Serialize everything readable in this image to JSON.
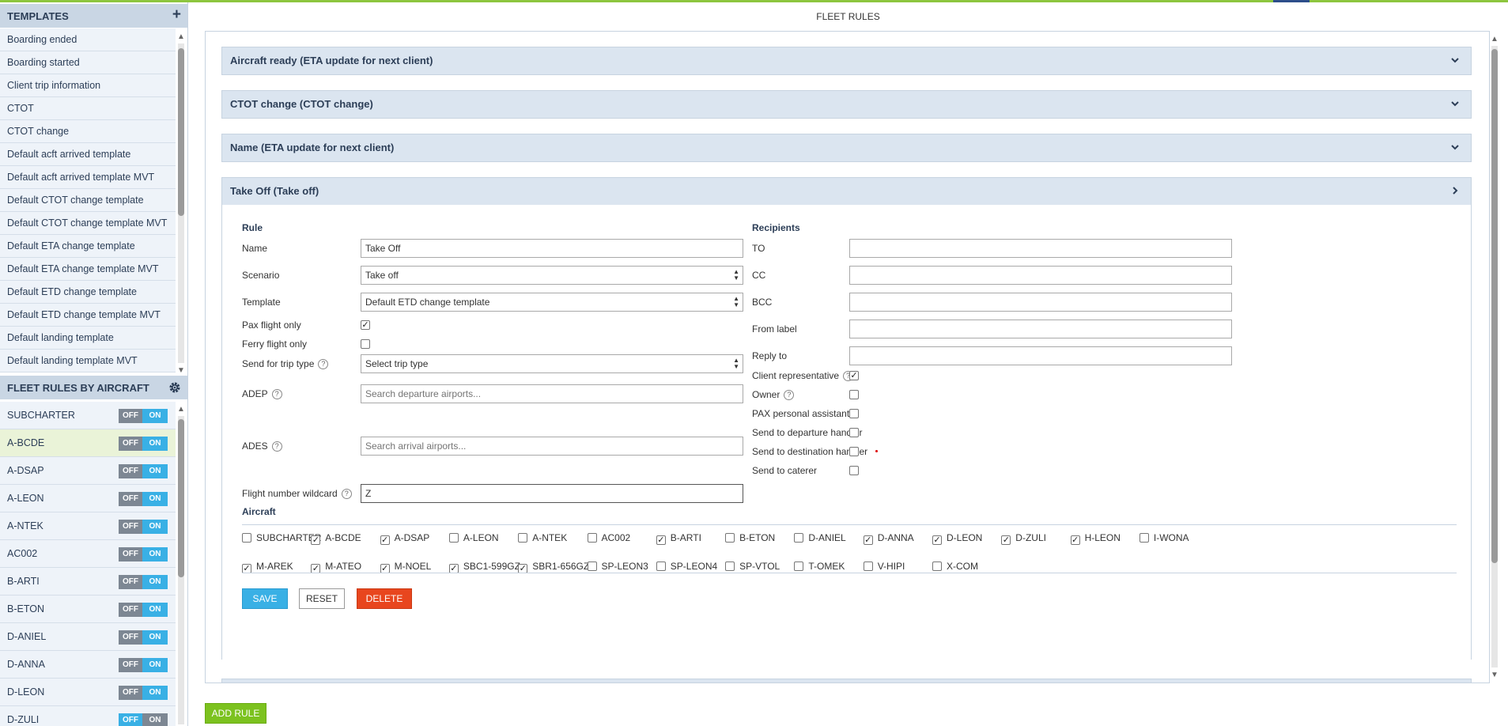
{
  "page": {
    "title": "FLEET RULES"
  },
  "colors": {
    "accent": "#39b0e5",
    "brand_green": "#8dc63f",
    "delete": "#e8461e",
    "header_bg": "#c9d6e4"
  },
  "sidebar": {
    "templates_header": "TEMPLATES",
    "templates_add_icon": "+",
    "templates": [
      "Boarding ended",
      "Boarding started",
      "Client trip information",
      "CTOT",
      "CTOT change",
      "Default acft arrived template",
      "Default acft arrived template MVT",
      "Default CTOT change template",
      "Default CTOT change template MVT",
      "Default ETA change template",
      "Default ETA change template MVT",
      "Default ETD change template",
      "Default ETD change template MVT",
      "Default landing template",
      "Default landing template MVT"
    ],
    "fleet_header": "FLEET RULES BY AIRCRAFT",
    "fleet_settings_icon": "gear-icon",
    "fleet": [
      {
        "name": "SUBCHARTER",
        "off": "OFF",
        "on": "ON"
      },
      {
        "name": "A-BCDE",
        "off": "OFF",
        "on": "ON"
      },
      {
        "name": "A-DSAP",
        "off": "OFF",
        "on": "ON"
      },
      {
        "name": "A-LEON",
        "off": "OFF",
        "on": "ON"
      },
      {
        "name": "A-NTEK",
        "off": "OFF",
        "on": "ON"
      },
      {
        "name": "AC002",
        "off": "OFF",
        "on": "ON"
      },
      {
        "name": "B-ARTI",
        "off": "OFF",
        "on": "ON"
      },
      {
        "name": "B-ETON",
        "off": "OFF",
        "on": "ON"
      },
      {
        "name": "D-ANIEL",
        "off": "OFF",
        "on": "ON"
      },
      {
        "name": "D-ANNA",
        "off": "OFF",
        "on": "ON"
      },
      {
        "name": "D-LEON",
        "off": "OFF",
        "on": "ON"
      },
      {
        "name": "D-ZULI",
        "off": "OFF",
        "on": "ON"
      }
    ]
  },
  "rules": {
    "collapsed": [
      "Aircraft ready (ETA update for next client)",
      "CTOT change (CTOT change)",
      "Name (ETA update for next client)"
    ],
    "expanded_title": "Take Off (Take off)",
    "rule_section": "Rule",
    "fields": {
      "name_label": "Name",
      "name_value": "Take Off",
      "scenario_label": "Scenario",
      "scenario_value": "Take off",
      "template_label": "Template",
      "template_value": "Default ETD change template",
      "pax_label": "Pax flight only",
      "ferry_label": "Ferry flight only",
      "trip_type_label": "Send for trip type",
      "trip_type_value": "Select trip type",
      "adep_label": "ADEP",
      "adep_placeholder": "Search departure airports...",
      "ades_label": "ADES",
      "ades_placeholder": "Search arrival airports...",
      "flight_number_label": "Flight number wildcard",
      "flight_number_value": "Z"
    },
    "recipients_section": "Recipients",
    "recipients": {
      "to_label": "TO",
      "cc_label": "CC",
      "bcc_label": "BCC",
      "from_label": "From label",
      "reply_to_label": "Reply to",
      "client_rep_label": "Client representative",
      "owner_label": "Owner",
      "pax_assistant_label": "PAX personal assistant",
      "dep_handler_label": "Send to departure handler",
      "dest_handler_label": "Send to destination handler",
      "caterer_label": "Send to caterer"
    },
    "aircraft_section": "Aircraft",
    "aircraft_row1": [
      {
        "name": "SUBCHARTER",
        "checked": false
      },
      {
        "name": "A-BCDE",
        "checked": true
      },
      {
        "name": "A-DSAP",
        "checked": true
      },
      {
        "name": "A-LEON",
        "checked": false
      },
      {
        "name": "A-NTEK",
        "checked": false
      },
      {
        "name": "AC002",
        "checked": false
      },
      {
        "name": "B-ARTI",
        "checked": true
      },
      {
        "name": "B-ETON",
        "checked": false
      },
      {
        "name": "D-ANIEL",
        "checked": false
      },
      {
        "name": "D-ANNA",
        "checked": true
      },
      {
        "name": "D-LEON",
        "checked": true
      },
      {
        "name": "D-ZULI",
        "checked": true
      },
      {
        "name": "H-LEON",
        "checked": true
      },
      {
        "name": "I-WONA",
        "checked": false
      }
    ],
    "aircraft_row2": [
      {
        "name": "M-AREK",
        "checked": true
      },
      {
        "name": "M-ATEO",
        "checked": true
      },
      {
        "name": "M-NOEL",
        "checked": true
      },
      {
        "name": "SBC1-599GZ",
        "checked": true
      },
      {
        "name": "SBR1-656GZ",
        "checked": true
      },
      {
        "name": "SP-LEON3",
        "checked": false
      },
      {
        "name": "SP-LEON4",
        "checked": false
      },
      {
        "name": "SP-VTOL",
        "checked": false
      },
      {
        "name": "T-OMEK",
        "checked": false
      },
      {
        "name": "V-HIPI",
        "checked": false
      },
      {
        "name": "X-COM",
        "checked": false
      }
    ],
    "buttons": {
      "save": "SAVE",
      "reset": "RESET",
      "delete": "DELETE"
    },
    "add_rule": "ADD RULE"
  }
}
